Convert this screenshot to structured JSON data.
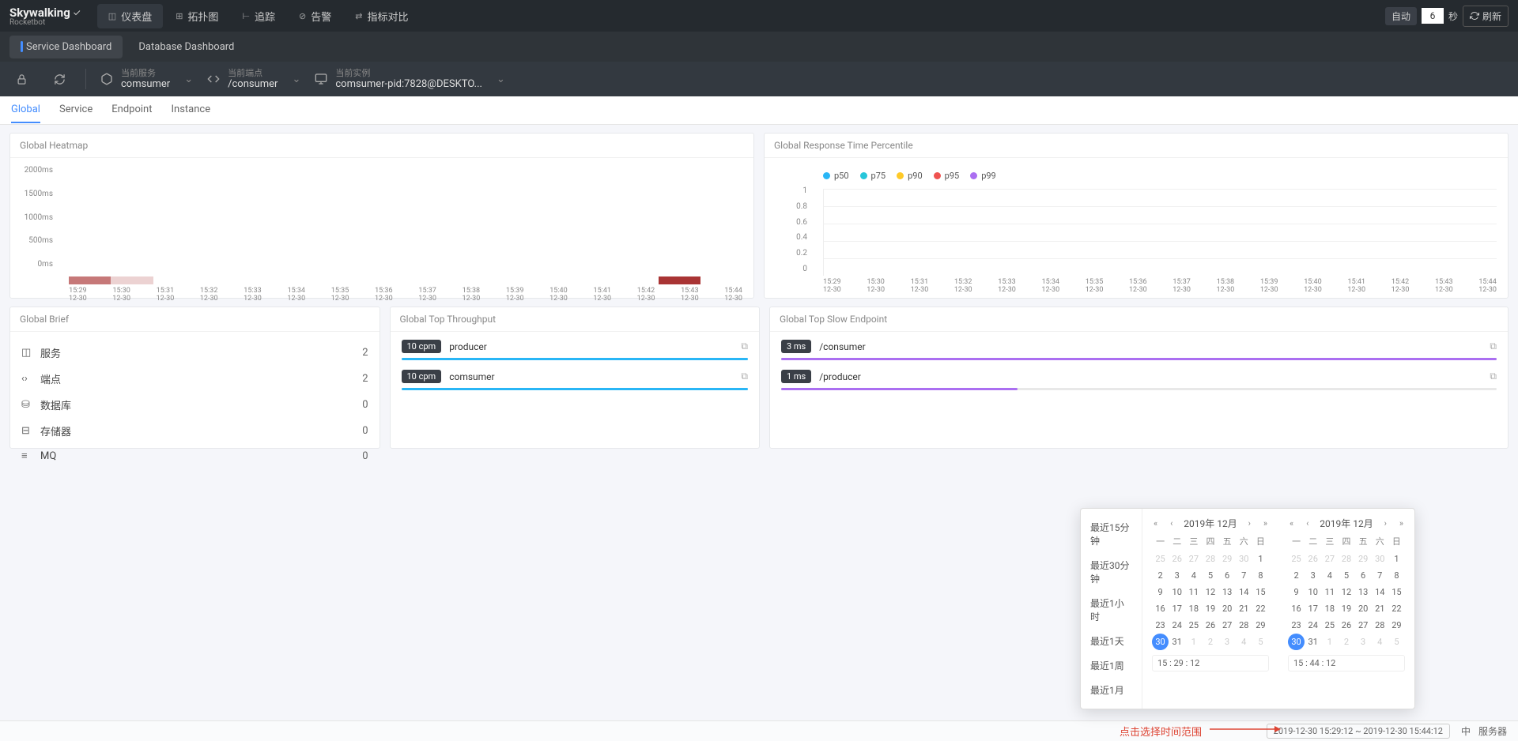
{
  "logo": {
    "title": "Skywalking",
    "sub": "Rocketbot"
  },
  "nav": [
    {
      "label": "仪表盘",
      "active": true
    },
    {
      "label": "拓扑图",
      "active": false
    },
    {
      "label": "追踪",
      "active": false
    },
    {
      "label": "告警",
      "active": false
    },
    {
      "label": "指标对比",
      "active": false
    }
  ],
  "header_right": {
    "auto": "自动",
    "seconds": "6",
    "sec_label": "秒",
    "refresh": "刷新"
  },
  "dashboard_tabs": [
    {
      "label": "Service Dashboard",
      "active": true
    },
    {
      "label": "Database Dashboard",
      "active": false
    }
  ],
  "selectors": {
    "service": {
      "label": "当前服务",
      "value": "comsumer"
    },
    "endpoint": {
      "label": "当前端点",
      "value": "/consumer"
    },
    "instance": {
      "label": "当前实例",
      "value": "comsumer-pid:7828@DESKTO..."
    }
  },
  "subtabs": [
    "Global",
    "Service",
    "Endpoint",
    "Instance"
  ],
  "subtab_active": "Global",
  "panels": {
    "heatmap": {
      "title": "Global Heatmap"
    },
    "percentile": {
      "title": "Global Response Time Percentile"
    },
    "brief": {
      "title": "Global Brief"
    },
    "throughput": {
      "title": "Global Top Throughput"
    },
    "slow": {
      "title": "Global Top Slow Endpoint"
    }
  },
  "chart_data": {
    "heatmap": {
      "type": "heatmap",
      "y_ticks": [
        "2000ms",
        "1500ms",
        "1000ms",
        "500ms",
        "0ms"
      ],
      "x_times": [
        "15:29",
        "15:30",
        "15:31",
        "15:32",
        "15:33",
        "15:34",
        "15:35",
        "15:36",
        "15:37",
        "15:38",
        "15:39",
        "15:40",
        "15:41",
        "15:42",
        "15:43",
        "15:44"
      ],
      "x_date": "12-30",
      "heat_points": [
        {
          "x": 0,
          "intensity": 0.6,
          "w": 1
        },
        {
          "x": 1,
          "intensity": 0.2,
          "w": 1
        },
        {
          "x": 14,
          "intensity": 0.9,
          "w": 1
        }
      ]
    },
    "percentile": {
      "type": "line",
      "series": [
        {
          "name": "p50",
          "color": "#29b6f6",
          "values": []
        },
        {
          "name": "p75",
          "color": "#26c6da",
          "values": []
        },
        {
          "name": "p90",
          "color": "#ffca28",
          "values": []
        },
        {
          "name": "p95",
          "color": "#ef5350",
          "values": []
        },
        {
          "name": "p99",
          "color": "#ab6ff1",
          "values": []
        }
      ],
      "y_ticks": [
        "1",
        "0.8",
        "0.6",
        "0.4",
        "0.2",
        "0"
      ],
      "x_times": [
        "15:29",
        "15:30",
        "15:31",
        "15:32",
        "15:33",
        "15:34",
        "15:35",
        "15:36",
        "15:37",
        "15:38",
        "15:39",
        "15:40",
        "15:41",
        "15:42",
        "15:43",
        "15:44"
      ],
      "x_date": "12-30",
      "ylim": [
        0,
        1
      ]
    }
  },
  "brief": [
    {
      "icon": "cube",
      "label": "服务",
      "value": "2"
    },
    {
      "icon": "code",
      "label": "端点",
      "value": "2"
    },
    {
      "icon": "db",
      "label": "数据库",
      "value": "0"
    },
    {
      "icon": "cache",
      "label": "存储器",
      "value": "0"
    },
    {
      "icon": "mq",
      "label": "MQ",
      "value": "0"
    }
  ],
  "throughput": [
    {
      "badge": "10 cpm",
      "name": "producer",
      "fill": 100,
      "color": "#29b6f6"
    },
    {
      "badge": "10 cpm",
      "name": "comsumer",
      "fill": 100,
      "color": "#29b6f6"
    }
  ],
  "slow": [
    {
      "badge": "3 ms",
      "name": "/consumer",
      "fill": 100,
      "color": "#ab6ff1"
    },
    {
      "badge": "1 ms",
      "name": "/producer",
      "fill": 33,
      "color": "#ab6ff1"
    }
  ],
  "datepicker": {
    "presets": [
      "最近15分钟",
      "最近30分钟",
      "最近1小时",
      "最近1天",
      "最近1周",
      "最近1月"
    ],
    "month_label": "2019年 12月",
    "dow": [
      "一",
      "二",
      "三",
      "四",
      "五",
      "六",
      "日"
    ],
    "left": {
      "weeks": [
        [
          {
            "d": "25",
            "m": true
          },
          {
            "d": "26",
            "m": true
          },
          {
            "d": "27",
            "m": true
          },
          {
            "d": "28",
            "m": true
          },
          {
            "d": "29",
            "m": true
          },
          {
            "d": "30",
            "m": true
          },
          {
            "d": "1"
          }
        ],
        [
          {
            "d": "2"
          },
          {
            "d": "3"
          },
          {
            "d": "4"
          },
          {
            "d": "5"
          },
          {
            "d": "6"
          },
          {
            "d": "7"
          },
          {
            "d": "8"
          }
        ],
        [
          {
            "d": "9"
          },
          {
            "d": "10"
          },
          {
            "d": "11"
          },
          {
            "d": "12"
          },
          {
            "d": "13"
          },
          {
            "d": "14"
          },
          {
            "d": "15"
          }
        ],
        [
          {
            "d": "16"
          },
          {
            "d": "17"
          },
          {
            "d": "18"
          },
          {
            "d": "19"
          },
          {
            "d": "20"
          },
          {
            "d": "21"
          },
          {
            "d": "22"
          }
        ],
        [
          {
            "d": "23"
          },
          {
            "d": "24"
          },
          {
            "d": "25"
          },
          {
            "d": "26"
          },
          {
            "d": "27"
          },
          {
            "d": "28"
          },
          {
            "d": "29"
          }
        ],
        [
          {
            "d": "30",
            "sel": true
          },
          {
            "d": "31"
          },
          {
            "d": "1",
            "m": true
          },
          {
            "d": "2",
            "m": true
          },
          {
            "d": "3",
            "m": true
          },
          {
            "d": "4",
            "m": true
          },
          {
            "d": "5",
            "m": true
          }
        ]
      ],
      "time": "15 : 29 : 12"
    },
    "right": {
      "weeks": [
        [
          {
            "d": "25",
            "m": true
          },
          {
            "d": "26",
            "m": true
          },
          {
            "d": "27",
            "m": true
          },
          {
            "d": "28",
            "m": true
          },
          {
            "d": "29",
            "m": true
          },
          {
            "d": "30",
            "m": true
          },
          {
            "d": "1"
          }
        ],
        [
          {
            "d": "2"
          },
          {
            "d": "3"
          },
          {
            "d": "4"
          },
          {
            "d": "5"
          },
          {
            "d": "6"
          },
          {
            "d": "7"
          },
          {
            "d": "8"
          }
        ],
        [
          {
            "d": "9"
          },
          {
            "d": "10"
          },
          {
            "d": "11"
          },
          {
            "d": "12"
          },
          {
            "d": "13"
          },
          {
            "d": "14"
          },
          {
            "d": "15"
          }
        ],
        [
          {
            "d": "16"
          },
          {
            "d": "17"
          },
          {
            "d": "18"
          },
          {
            "d": "19"
          },
          {
            "d": "20"
          },
          {
            "d": "21"
          },
          {
            "d": "22"
          }
        ],
        [
          {
            "d": "23"
          },
          {
            "d": "24"
          },
          {
            "d": "25"
          },
          {
            "d": "26"
          },
          {
            "d": "27"
          },
          {
            "d": "28"
          },
          {
            "d": "29"
          }
        ],
        [
          {
            "d": "30",
            "sel": true
          },
          {
            "d": "31"
          },
          {
            "d": "1",
            "m": true
          },
          {
            "d": "2",
            "m": true
          },
          {
            "d": "3",
            "m": true
          },
          {
            "d": "4",
            "m": true
          },
          {
            "d": "5",
            "m": true
          }
        ]
      ],
      "time": "15 : 44 : 12"
    }
  },
  "footer": {
    "hint": "点击选择时间范围",
    "range": "2019-12-30 15:29:12 ~ 2019-12-30 15:44:12",
    "lang": "中",
    "server": "服务器"
  }
}
